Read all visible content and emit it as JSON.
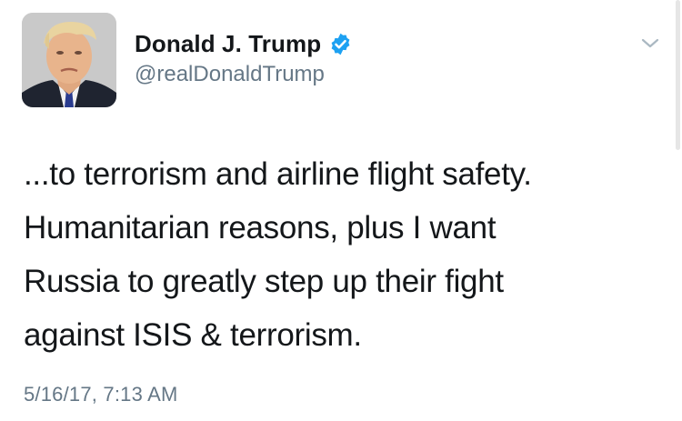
{
  "author": {
    "display_name": "Donald J. Trump",
    "handle": "@realDonaldTrump",
    "verified": true,
    "verified_color": "#1da1f2"
  },
  "tweet": {
    "lines": [
      "...to terrorism and airline flight safety.",
      "Humanitarian reasons, plus I want",
      "Russia to greatly step up their fight",
      "against ISIS & terrorism."
    ],
    "timestamp": "5/16/17, 7:13 AM"
  },
  "icons": {
    "menu": "chevron-down-icon",
    "verified": "verified-badge-icon"
  },
  "colors": {
    "text": "#14171a",
    "secondary_text": "#657786",
    "background": "#ffffff"
  }
}
